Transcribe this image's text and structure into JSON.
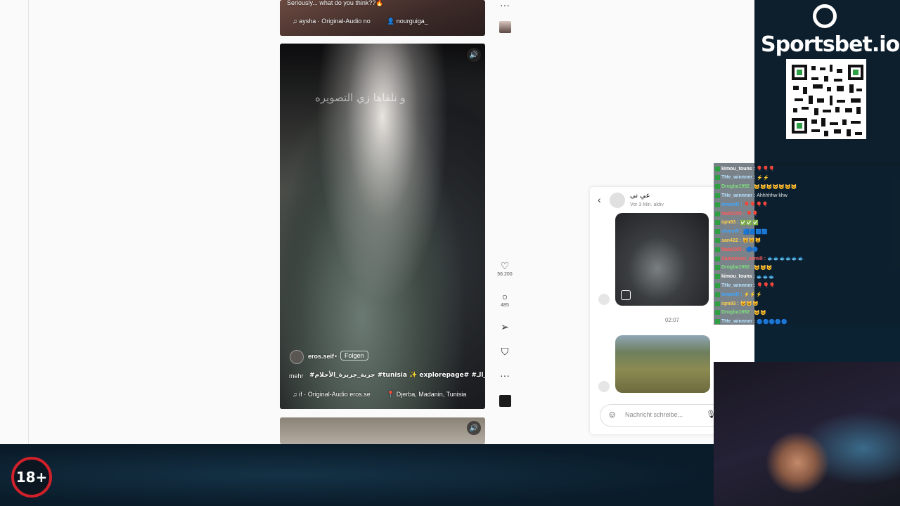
{
  "reels": {
    "top": {
      "caption": "Seriously... what do you think??🔥",
      "audio": "♫ aysha · Original-Audio  no",
      "user": "👤 nourguiga_"
    },
    "main": {
      "overlay_text": "و نلقاها زي التصويره",
      "username": "eros.seif",
      "dot": "•",
      "follow_label": "Folgen",
      "caption": "#جربة_جزيرة_الأحلام #tunisia ✨ explorepage# #تونس_الـ...",
      "more_label": "mehr",
      "audio": "♫ if · Original-Audio  eros.se",
      "location": "📍 Djerba, Madanin, Tunisia"
    },
    "actions": {
      "likes": "56.200",
      "comments": "485"
    }
  },
  "icons": {
    "sound": "speaker-icon",
    "like": "heart-icon",
    "comment": "comment-icon",
    "share": "send-icon",
    "save": "bookmark-icon",
    "more": "more-icon",
    "back": "chevron-left-icon",
    "emoji": "emoji-icon",
    "mic": "microphone-icon"
  },
  "chat": {
    "name": "عي نى",
    "status": "Vor 3 Min. aktiv",
    "timestamp": "02:07",
    "input_placeholder": "Nachricht schreibe..."
  },
  "overlay": {
    "brand": "Sportsbet.io",
    "age_badge": "18+",
    "feed": [
      {
        "name": "kimou_touns",
        "msg": "🎈🎈🎈",
        "color": "#ffffff"
      },
      {
        "name": "THe_winnner",
        "msg": "⚡⚡",
        "color": "#b6e3ff"
      },
      {
        "name": "Drogba1992",
        "msg": "😺😺😺😺😺😺😺",
        "color": "#7ee07e"
      },
      {
        "name": "THe_winnner",
        "msg": "Ahhhhhw khw",
        "color": "#b6e3ff"
      },
      {
        "name": "kmaniR",
        "msg": "🎈🎈🎈🎈",
        "color": "#3fa7ff"
      },
      {
        "name": "Nabil105",
        "msg": "🎈🎈",
        "color": "#ff5a5a"
      },
      {
        "name": "iqm93",
        "msg": "✅✅✅",
        "color": "#ffd24a"
      },
      {
        "name": "chmeW",
        "msg": "🟦🟦🟦🟦",
        "color": "#3fa7ff"
      },
      {
        "name": "san422",
        "msg": "😺😺😺",
        "color": "#ffd24a"
      },
      {
        "name": "Nabil105",
        "msg": "🔵🔵",
        "color": "#ff5a5a"
      },
      {
        "name": "Samoeven_semill",
        "msg": "🐟🐟🐟🐟🐟🐟",
        "color": "#ff5a5a"
      },
      {
        "name": "Drogba1992",
        "msg": "😺😺😺",
        "color": "#7ee07e"
      },
      {
        "name": "kimou_touns",
        "msg": "🐟🐟🐟",
        "color": "#ffffff"
      },
      {
        "name": "THe_winnner",
        "msg": "🎈🎈🎈",
        "color": "#b6e3ff"
      },
      {
        "name": "kmaniR",
        "msg": "⚡⚡⚡",
        "color": "#3fa7ff"
      },
      {
        "name": "iqm93",
        "msg": "😺😺😺",
        "color": "#ffd24a"
      },
      {
        "name": "Drogba1992",
        "msg": "😺😺",
        "color": "#7ee07e"
      },
      {
        "name": "THe_winnner",
        "msg": "🔵🔵🔵🔵🔵",
        "color": "#b6e3ff"
      }
    ]
  }
}
